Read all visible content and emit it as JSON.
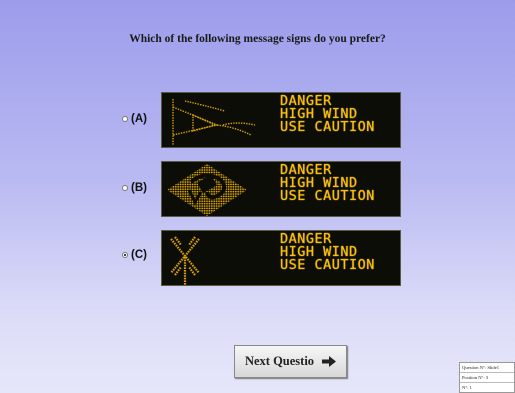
{
  "question": "Which of the following message signs do you prefer?",
  "options": [
    {
      "label": "(A)",
      "selected": false,
      "symbol": "flag-icon",
      "lines": [
        "DANGER",
        "HIGH WIND",
        "USE CAUTION"
      ]
    },
    {
      "label": "(B)",
      "selected": false,
      "symbol": "wind-diamond-icon",
      "lines": [
        "DANGER",
        "HIGH WIND",
        "USE CAUTION"
      ]
    },
    {
      "label": "(C)",
      "selected": true,
      "symbol": "windmill-icon",
      "lines": [
        "DANGER",
        "HIGH WIND",
        "USE CAUTION"
      ]
    }
  ],
  "next_button": {
    "label": "Next Questio",
    "icon": "arrow-right-icon"
  },
  "info": {
    "question_no": "Question N°: Slide1",
    "position_no": "Position N°: 3",
    "number": "N°: 1"
  },
  "colors": {
    "led": "#ffc000",
    "panel": "#0d0d08"
  }
}
